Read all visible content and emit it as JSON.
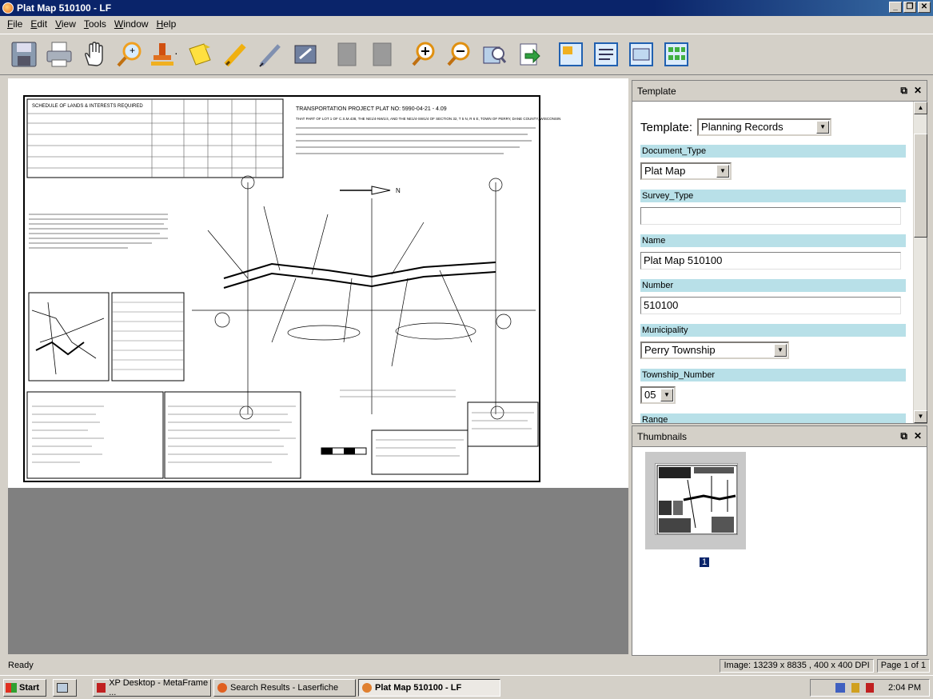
{
  "window": {
    "title": "Plat Map 510100 - LF"
  },
  "menu": [
    "File",
    "Edit",
    "View",
    "Tools",
    "Window",
    "Help"
  ],
  "toolbar": {
    "icons": [
      "save-icon",
      "print-icon",
      "hand-pan-icon",
      "zoom-tool-icon",
      "stamp-icon",
      "sticky-note-icon",
      "highlighter-icon",
      "pen-icon",
      "eraser-icon",
      "page-icon",
      "page-icon",
      "zoom-in-icon",
      "zoom-out-icon",
      "fit-page-icon",
      "export-icon",
      "thumbnail-icon",
      "text-icon",
      "folder-icon",
      "grid-icon"
    ]
  },
  "document": {
    "page_heading": "TRANSPORTATION PROJECT PLAT NO: 5990-04-21 - 4.09",
    "page_subheading": "THAT PART OF LOT 1 OF C.S.M.438, THE NE1/4-NW1/4, AND THE NE1/4-SW1/4 OF SECTION 32, T 5 N, R 6 E, TOWN OF PERRY, DANE COUNTY, WISCONSIN",
    "schedule_title": "SCHEDULE OF LANDS & INTERESTS REQUIRED",
    "north_arrow": "N"
  },
  "template_panel": {
    "title": "Template",
    "template_label": "Template:",
    "template_value": "Planning Records",
    "fields": {
      "document_type": {
        "label": "Document_Type",
        "value": "Plat Map"
      },
      "survey_type": {
        "label": "Survey_Type",
        "value": ""
      },
      "name": {
        "label": "Name",
        "value": "Plat Map 510100"
      },
      "number": {
        "label": "Number",
        "value": "510100"
      },
      "municipality": {
        "label": "Municipality",
        "value": "Perry Township"
      },
      "township_number": {
        "label": "Township_Number",
        "value": "05"
      },
      "range": {
        "label": "Range",
        "value": ""
      }
    }
  },
  "thumbnails_panel": {
    "title": "Thumbnails",
    "page_number": "1"
  },
  "status": {
    "left": "Ready",
    "image_info": "Image: 13239 x 8835 , 400 x 400 DPI",
    "page_info": "Page 1 of 1"
  },
  "taskbar": {
    "start": "Start",
    "items": [
      "XP Desktop - MetaFrame ...",
      "Search Results - Laserfiche",
      "Plat Map 510100 - LF"
    ],
    "clock": "2:04 PM"
  },
  "colors": {
    "title_bar": "#0a246a",
    "field_label_bg": "#b8e0e8",
    "chrome": "#d4d0c8"
  }
}
